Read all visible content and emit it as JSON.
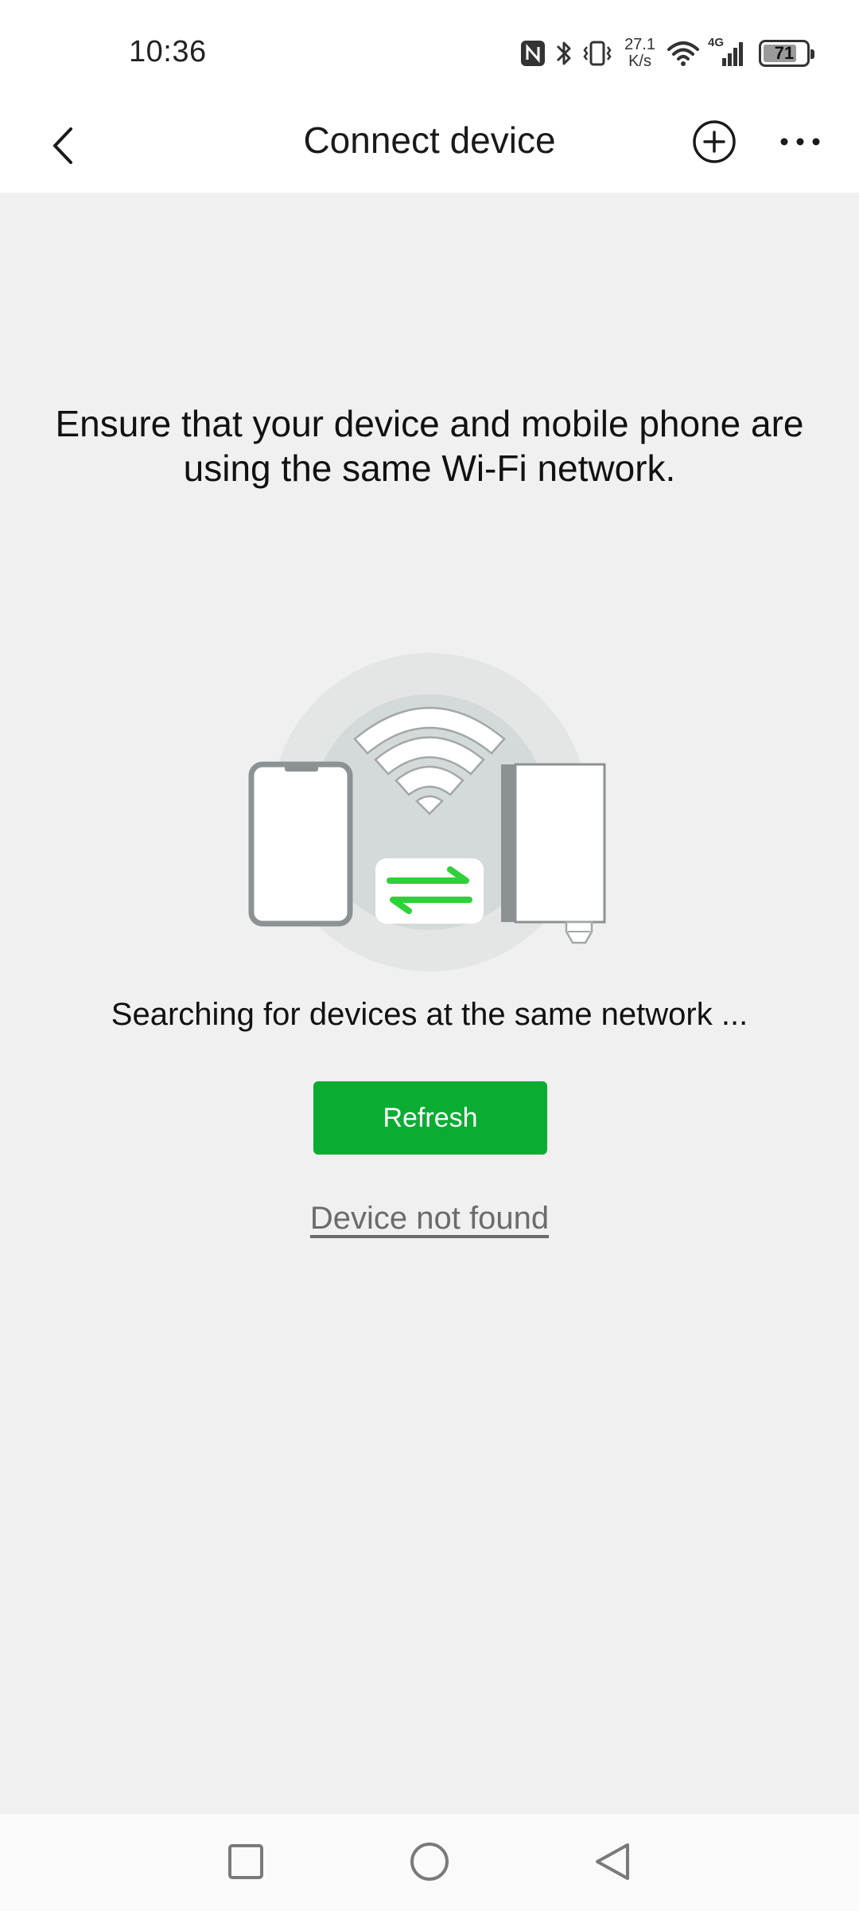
{
  "status_bar": {
    "time": "10:36",
    "net_speed_value": "27.1",
    "net_speed_unit": "K/s",
    "network_type": "4G",
    "battery_level": "71",
    "icons": [
      "nfc-icon",
      "bluetooth-icon",
      "vibrate-icon",
      "wifi-icon",
      "signal-icon",
      "battery-icon"
    ]
  },
  "header": {
    "title": "Connect device",
    "back_icon": "chevron-left-icon",
    "add_icon": "plus-circle-icon",
    "more_icon": "more-horizontal-icon"
  },
  "main": {
    "instruction": "Ensure that your device and mobile phone are using the same Wi-Fi network.",
    "searching_text": "Searching for devices at the same network ...",
    "refresh_label": "Refresh",
    "not_found_label": "Device not found"
  },
  "nav_bar": {
    "icons": [
      "recent-apps-icon",
      "home-icon",
      "back-icon"
    ]
  },
  "colors": {
    "accent": "#0aad32",
    "background": "#f0f0f0",
    "header_bg": "#ffffff",
    "link_gray": "#6b6b6b"
  }
}
